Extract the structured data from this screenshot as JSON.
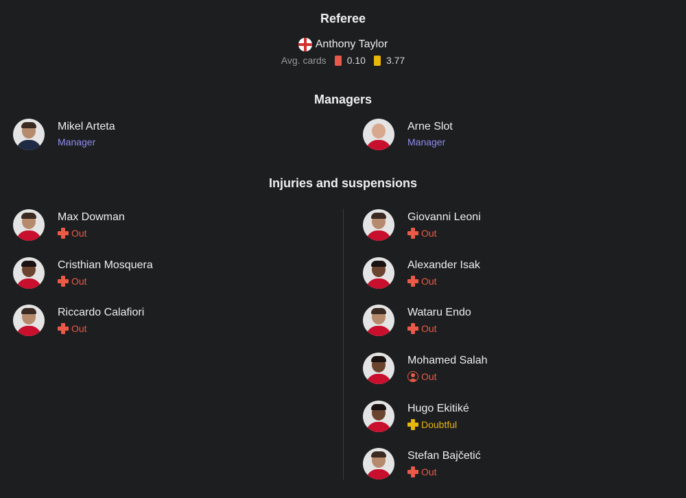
{
  "referee": {
    "title": "Referee",
    "name": "Anthony Taylor",
    "flag": "england-flag-icon",
    "avg_cards_label": "Avg. cards",
    "red_avg": "0.10",
    "yellow_avg": "3.77",
    "red_color": "#e8584b",
    "yellow_color": "#e8b70b"
  },
  "managers": {
    "title": "Managers",
    "home": {
      "name": "Mikel Arteta",
      "role": "Manager"
    },
    "away": {
      "name": "Arne Slot",
      "role": "Manager"
    }
  },
  "injuries": {
    "title": "Injuries and suspensions",
    "home": [
      {
        "name": "Max Dowman",
        "status": "Out",
        "icon": "injury-cross-icon"
      },
      {
        "name": "Cristhian Mosquera",
        "status": "Out",
        "icon": "injury-cross-icon"
      },
      {
        "name": "Riccardo Calafiori",
        "status": "Out",
        "icon": "injury-cross-icon"
      }
    ],
    "away": [
      {
        "name": "Giovanni Leoni",
        "status": "Out",
        "icon": "injury-cross-icon"
      },
      {
        "name": "Alexander Isak",
        "status": "Out",
        "icon": "injury-cross-icon"
      },
      {
        "name": "Wataru Endo",
        "status": "Out",
        "icon": "injury-cross-icon"
      },
      {
        "name": "Mohamed Salah",
        "status": "Out",
        "icon": "suspension-person-icon"
      },
      {
        "name": "Hugo Ekitiké",
        "status": "Doubtful",
        "icon": "injury-cross-icon"
      },
      {
        "name": "Stefan Bajčetić",
        "status": "Out",
        "icon": "injury-cross-icon"
      }
    ]
  },
  "colors": {
    "background": "#1d1e20",
    "manager_role": "#8f8cf0",
    "out": "#ea5a47",
    "doubtful": "#e8b70b"
  }
}
